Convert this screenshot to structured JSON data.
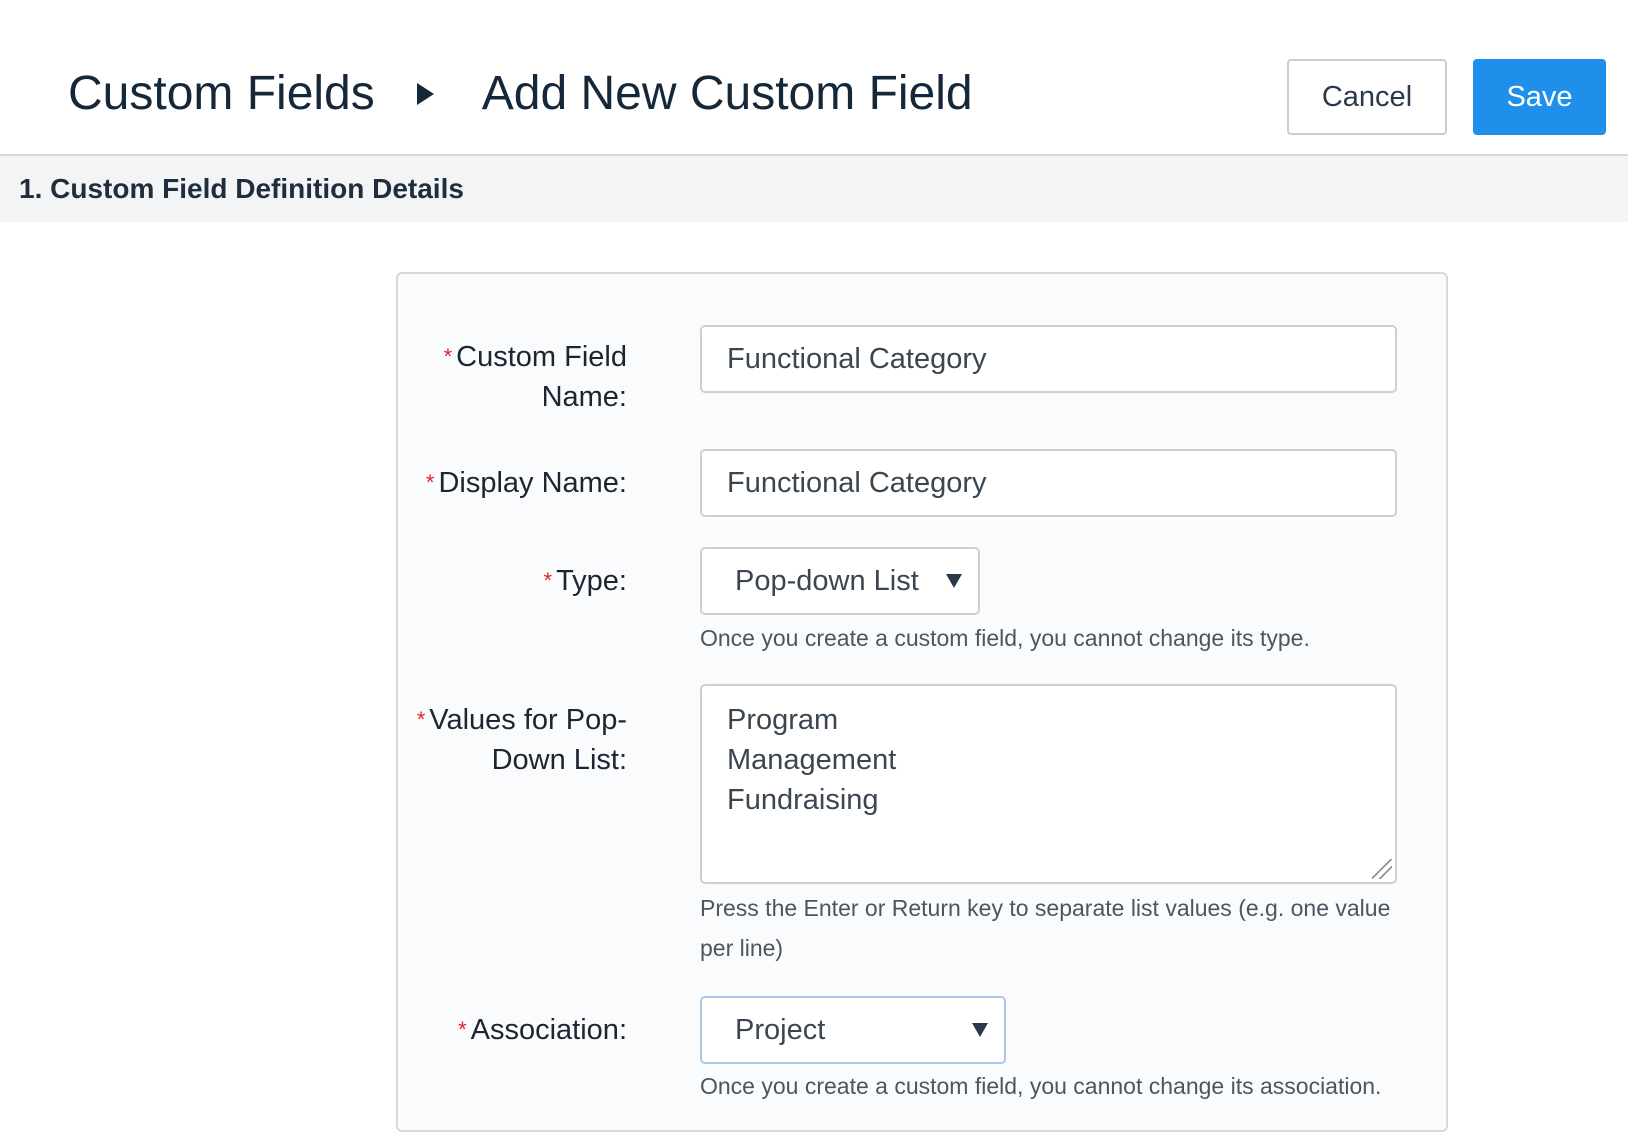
{
  "header": {
    "breadcrumb_parent": "Custom Fields",
    "breadcrumb_current": "Add New Custom Field",
    "cancel_label": "Cancel",
    "save_label": "Save"
  },
  "section": {
    "title": "1. Custom Field Definition Details"
  },
  "form": {
    "custom_field_name": {
      "label_line1": "Custom Field",
      "label_line2": "Name:",
      "value": "Functional Category"
    },
    "display_name": {
      "label": "Display Name:",
      "value": "Functional Category"
    },
    "type": {
      "label": "Type:",
      "selected": "Pop-down List",
      "help": "Once you create a custom field, you cannot change its type."
    },
    "values": {
      "label_line1": "Values for Pop-",
      "label_line2": "Down List:",
      "items": [
        "Program",
        "Management",
        "Fundraising"
      ],
      "help_line1": "Press the Enter or Return key to separate list values (e.g. one value",
      "help_line2": "per line)"
    },
    "association": {
      "label": "Association:",
      "selected": "Project",
      "help": "Once you create a custom field, you cannot change its association."
    },
    "required_marker": "*"
  },
  "colors": {
    "primary": "#1e90eb",
    "required": "#e0252b",
    "section_bg": "#f3f4f5"
  }
}
